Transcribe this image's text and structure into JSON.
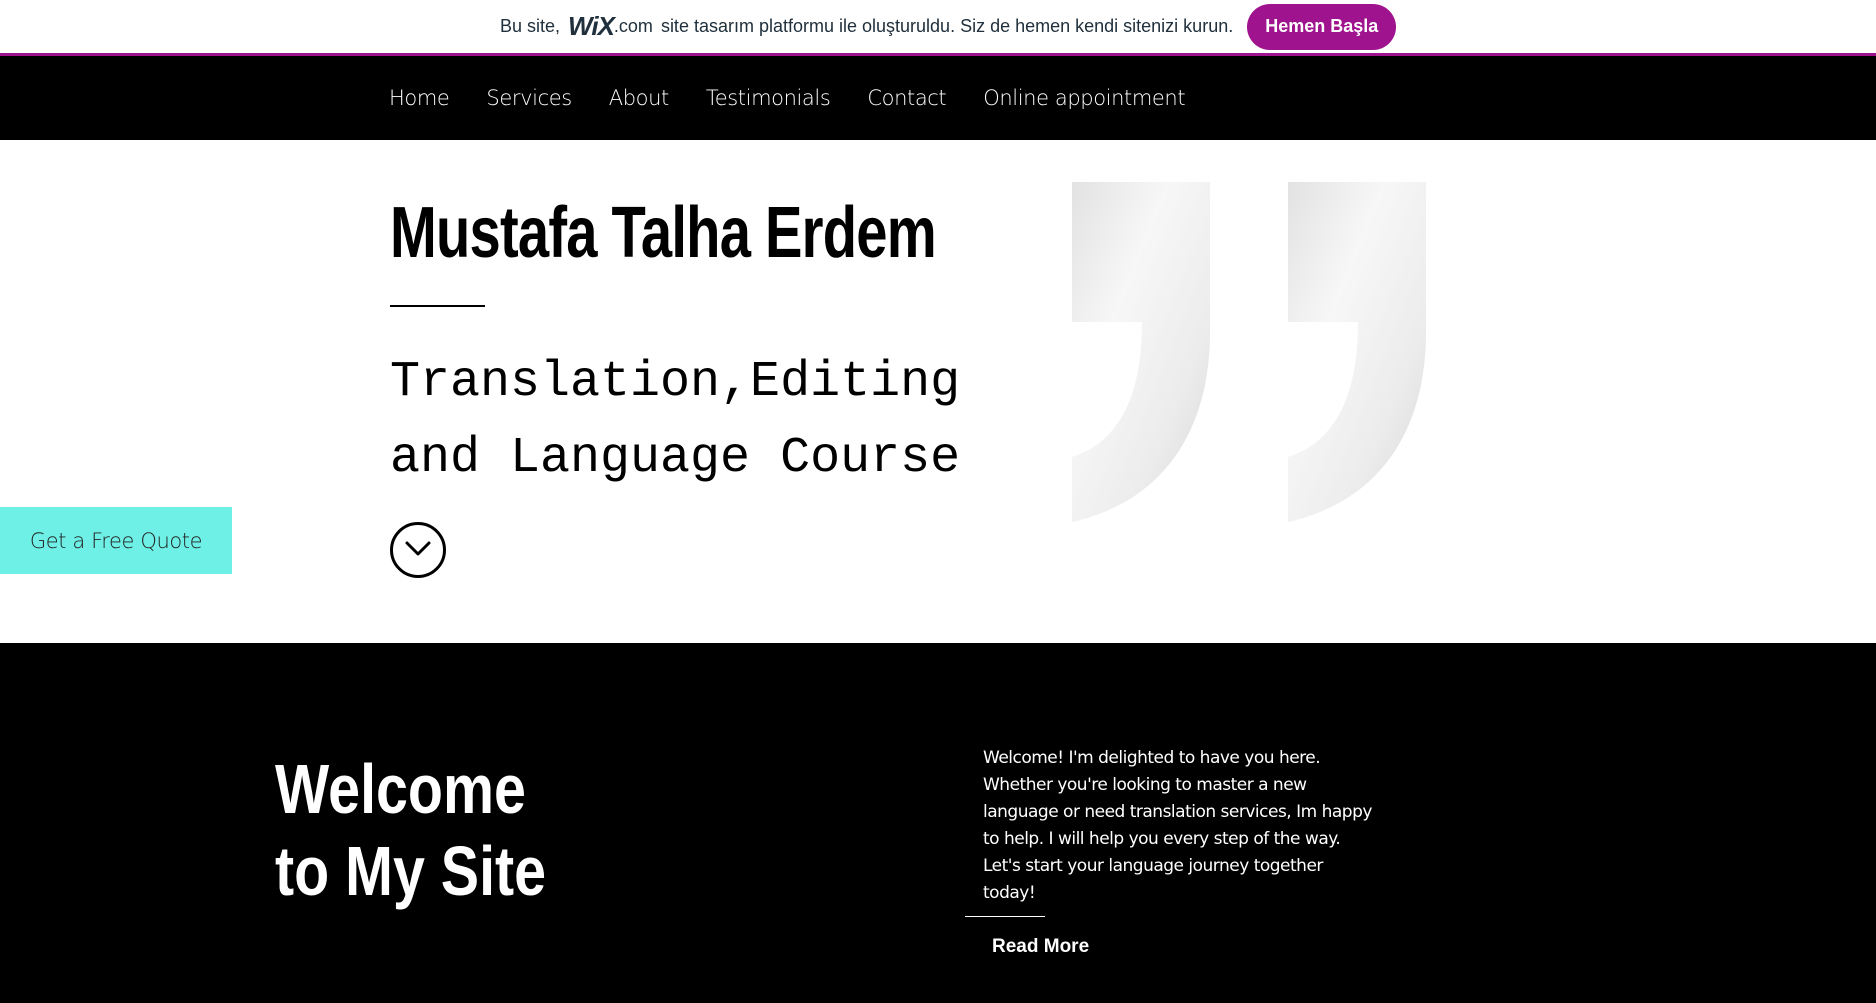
{
  "wix_banner": {
    "text_before": "Bu site,",
    "logo": "WiX",
    "logo_suffix": ".com",
    "text_after": "site tasarım platformu ile oluşturuldu. Siz de hemen kendi sitenizi kurun.",
    "cta_label": "Hemen Başla",
    "accent_color": "#a0138e"
  },
  "nav": {
    "items": [
      {
        "label": "Home"
      },
      {
        "label": "Services"
      },
      {
        "label": "About"
      },
      {
        "label": "Testimonials"
      },
      {
        "label": "Contact"
      },
      {
        "label": "Online appointment"
      }
    ]
  },
  "hero": {
    "name": "Mustafa Talha Erdem",
    "subtitle_line1": "Translation,Editing",
    "subtitle_line2": "and Language Course",
    "scroll_icon": "chevron-down-circle-icon",
    "quote_icon": "closing-quote-marks-icon"
  },
  "free_quote": {
    "label": "Get a Free Quote",
    "color": "#6ef0e6"
  },
  "welcome": {
    "title_line1": "Welcome",
    "title_line2": "to My Site",
    "body": "Welcome! I'm delighted to have you here. Whether you're looking to master a new language or need translation services, Im happy to help. I will help you every step of the way. Let's start your language journey together today!",
    "read_more_label": "Read More"
  }
}
